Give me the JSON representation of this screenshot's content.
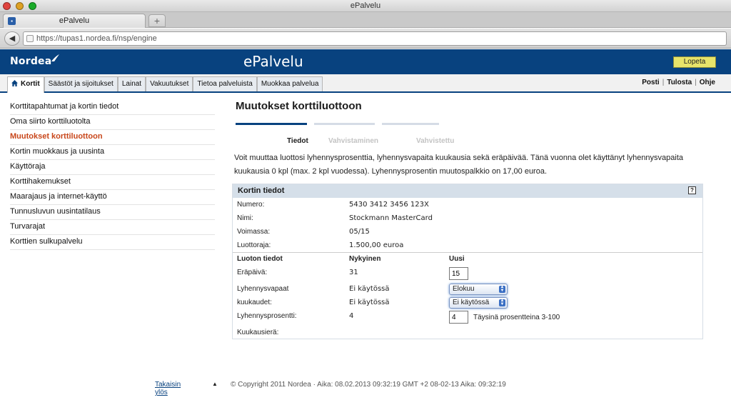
{
  "browser": {
    "window_title": "ePalvelu",
    "tab_title": "ePalvelu",
    "new_tab_label": "+",
    "url": "https://tupas1.nordea.fi/nsp/engine"
  },
  "header": {
    "logo_text": "Nordea",
    "app_title": "ePalvelu",
    "logout_label": "Lopeta",
    "brand_color": "#08427f"
  },
  "nav": {
    "tabs": [
      {
        "label": "Kortit",
        "active": true
      },
      {
        "label": "Säästöt ja sijoitukset"
      },
      {
        "label": "Lainat"
      },
      {
        "label": "Vakuutukset"
      },
      {
        "label": "Tietoa palveluista"
      },
      {
        "label": "Muokkaa palvelua"
      }
    ],
    "utility": [
      "Posti",
      "Tulosta",
      "Ohje"
    ]
  },
  "sidebar": {
    "items": [
      {
        "label": "Korttitapahtumat ja kortin tiedot"
      },
      {
        "label": "Oma siirto korttiluotolta"
      },
      {
        "label": "Muutokset korttiluottoon",
        "active": true
      },
      {
        "label": "Kortin muokkaus ja uusinta"
      },
      {
        "label": "Käyttöraja"
      },
      {
        "label": "Korttihakemukset"
      },
      {
        "label": "Maarajaus ja internet-käyttö"
      },
      {
        "label": "Tunnusluvun uusintatilaus"
      },
      {
        "label": "Turvarajat"
      },
      {
        "label": "Korttien sulkupalvelu"
      }
    ]
  },
  "main": {
    "title": "Muutokset korttiluottoon",
    "steps": [
      "Tiedot",
      "Vahvistaminen",
      "Vahvistettu"
    ],
    "intro_line1": "Voit muuttaa luottosi lyhennysprosenttia, lyhennysvapaita kuukausia sekä eräpäivää. Tänä vuonna olet käyttänyt lyhennysvapaita",
    "intro_line2": "kuukausia 0 kpl (max. 2 kpl vuodessa). Lyhennysprosentin muutospalkkio on 17,00 euroa.",
    "panel": {
      "title": "Kortin tiedot",
      "help": "?",
      "card_rows": [
        {
          "label": "Numero:",
          "value": "5430 3412 3456 123X"
        },
        {
          "label": "Nimi:",
          "value": "Stockmann MasterCard"
        },
        {
          "label": "Voimassa:",
          "value": "05/15"
        },
        {
          "label": "Luottoraja:",
          "value": "1.500,00 euroa"
        }
      ],
      "credit_header": {
        "label": "Luoton tiedot",
        "current": "Nykyinen",
        "new": "Uusi"
      },
      "due_day": {
        "label": "Eräpäivä:",
        "current": "31",
        "new": "15"
      },
      "free_months_label_1": "Lyhennysvapaat",
      "free_months_label_2": "kuukaudet:",
      "free_month_1": {
        "current": "Ei käytössä",
        "selected": "Elokuu"
      },
      "free_month_2": {
        "current": "Ei käytössä",
        "selected": "Ei käytössä"
      },
      "percent": {
        "label": "Lyhennysprosentti:",
        "current": "4",
        "new": "4",
        "hint": "Täysinä prosentteina 3-100"
      },
      "installment_label": "Kuukausierä:"
    }
  },
  "footer": {
    "back_to_top": "Takaisin ylös",
    "copyright": "© Copyright 2011 Nordea · Aika: 08.02.2013 09:32:19 GMT +2 08-02-13 Aika: 09:32:19"
  }
}
